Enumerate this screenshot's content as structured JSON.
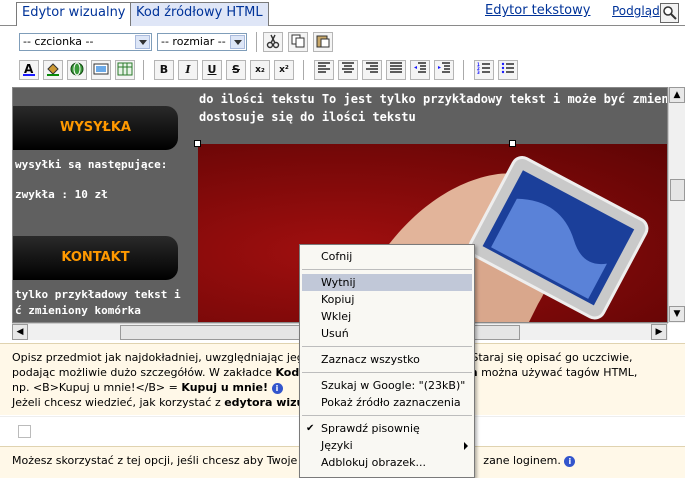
{
  "tabs": {
    "visual": "Edytor wizualny",
    "html": "Kod źródłowy HTML",
    "text": "Edytor tekstowy",
    "preview": "Podgląd"
  },
  "toolbar": {
    "font_select": "-- czcionka --",
    "size_select": "-- rozmiar --",
    "btn_bold": "B",
    "btn_italic": "I",
    "btn_underline": "U",
    "btn_strike": "S",
    "btn_sub": "x₂",
    "btn_sup": "x²"
  },
  "editor": {
    "top_text_line1": "do ilości tekstu To jest tylko przykładowy tekst i może być zmieniony, t",
    "top_text_line2": "dostosuje się do ilości tekstu",
    "btn_shipping": "WYSYŁKA",
    "shipping_line1": "wysyłki są następujące:",
    "shipping_line2": "zwykła : 10 zł",
    "btn_contact": "KONTAKT",
    "contact_line1": "tylko przykładowy tekst i",
    "contact_line2": "ć zmieniony komórka"
  },
  "info": {
    "line1_a": "Opisz przedmiot jak najdokładniej, uwzględniając jeg",
    "line1_b": "ady. Staraj się opisać go uczciwie,",
    "line2_a": "podając możliwie dużo szczegółów. W zakładce ",
    "line2_bold": "Kod",
    "line2_b": "owym",
    "line2_c": " można używać tagów HTML,",
    "line3_a": "np. <B>Kupuj u mnie!</B> = ",
    "line3_bold": "Kupuj u mnie!",
    "line4_a": "Jeżeli chcesz wiedzieć, jak korzystać z ",
    "line4_bold": "edytora wizua"
  },
  "note": {
    "text_a": "Możesz skorzystać z tej opcji, jeśli chcesz aby Twoje",
    "text_b": "zane loginem."
  },
  "context_menu": {
    "undo": "Cofnij",
    "cut": "Wytnij",
    "copy": "Kopiuj",
    "paste": "Wklej",
    "delete": "Usuń",
    "select_all": "Zaznacz wszystko",
    "search_google": "Szukaj w Google: \"(23kB)\"",
    "view_source": "Pokaż źródło zaznaczenia",
    "spellcheck": "Sprawdź pisownię",
    "languages": "Języki",
    "block_image": "Adblokuj obrazek..."
  },
  "colors": {
    "tab_link": "#003399",
    "editor_bg": "#606060",
    "button_text": "#ff9900",
    "photo_red": "#8b0a0a",
    "info_bg": "#fff8e8",
    "menu_highlight": "#c1c8d8"
  }
}
